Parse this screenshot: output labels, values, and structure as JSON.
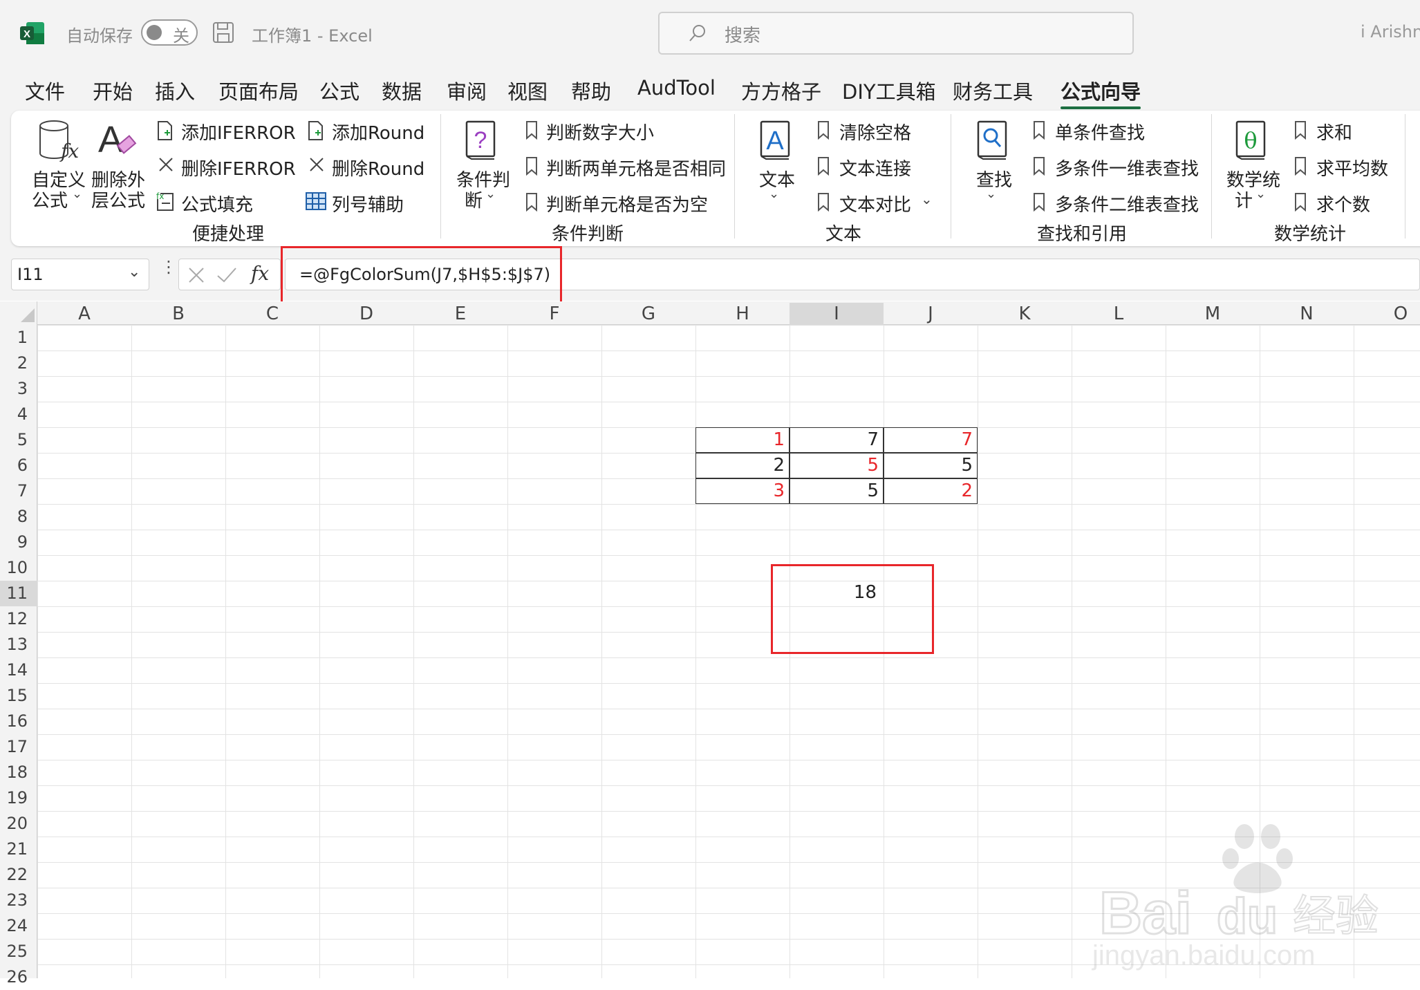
{
  "titlebar": {
    "autosave_label": "自动保存",
    "autosave_state": "关",
    "doc_title": "工作簿1  -  Excel",
    "search_placeholder": "搜索",
    "user": "i Arishn"
  },
  "tabs": [
    "文件",
    "开始",
    "插入",
    "页面布局",
    "公式",
    "数据",
    "审阅",
    "视图",
    "帮助",
    "AudTool",
    "方方格子",
    "DIY工具箱",
    "财务工具",
    "公式向导"
  ],
  "active_tab": "公式向导",
  "ribbon": {
    "g1": {
      "big1": "自定义\n公式",
      "big1_a": "自定义",
      "big1_b": "公式",
      "big2_a": "删除外",
      "big2_b": "层公式",
      "items": [
        "添加IFERROR",
        "删除IFERROR",
        "公式填充",
        "添加Round",
        "删除Round",
        "列号辅助"
      ],
      "label": "便捷处理"
    },
    "g2": {
      "big_a": "条件判",
      "big_b": "断",
      "items": [
        "判断数字大小",
        "判断两单元格是否相同",
        "判断单元格是否为空"
      ],
      "label": "条件判断"
    },
    "g3": {
      "big": "文本",
      "items": [
        "清除空格",
        "文本连接",
        "文本对比"
      ],
      "label": "文本"
    },
    "g4": {
      "big": "查找",
      "items": [
        "单条件查找",
        "多条件一维表查找",
        "多条件二维表查找"
      ],
      "label": "查找和引用"
    },
    "g5": {
      "big_a": "数学统",
      "big_b": "计",
      "items": [
        "求和",
        "求平均数",
        "求个数"
      ],
      "label": "数学统计"
    }
  },
  "formula_bar": {
    "name_box": "I11",
    "fx": "fx",
    "formula": "=@FgColorSum(J7,$H$5:$J$7)"
  },
  "grid": {
    "columns": [
      "A",
      "B",
      "C",
      "D",
      "E",
      "F",
      "G",
      "H",
      "I",
      "J",
      "K",
      "L",
      "M",
      "N",
      "O"
    ],
    "rows": [
      "1",
      "2",
      "3",
      "4",
      "5",
      "6",
      "7",
      "8",
      "9",
      "10",
      "11",
      "12",
      "13",
      "14",
      "15",
      "16",
      "17",
      "18",
      "19",
      "20",
      "21",
      "22",
      "23",
      "24",
      "25",
      "26"
    ],
    "table": [
      [
        {
          "v": "1",
          "c": "#e8262a"
        },
        {
          "v": "7",
          "c": "#222222"
        },
        {
          "v": "7",
          "c": "#e8262a"
        }
      ],
      [
        {
          "v": "2",
          "c": "#222222"
        },
        {
          "v": "5",
          "c": "#e8262a"
        },
        {
          "v": "5",
          "c": "#222222"
        }
      ],
      [
        {
          "v": "3",
          "c": "#e8262a"
        },
        {
          "v": "5",
          "c": "#222222"
        },
        {
          "v": "2",
          "c": "#e8262a"
        }
      ]
    ],
    "result_cell": "18"
  },
  "colors": {
    "excel_green": "#1d6f42",
    "highlight_red": "#e8262a",
    "gridline": "#e3e3e3"
  }
}
